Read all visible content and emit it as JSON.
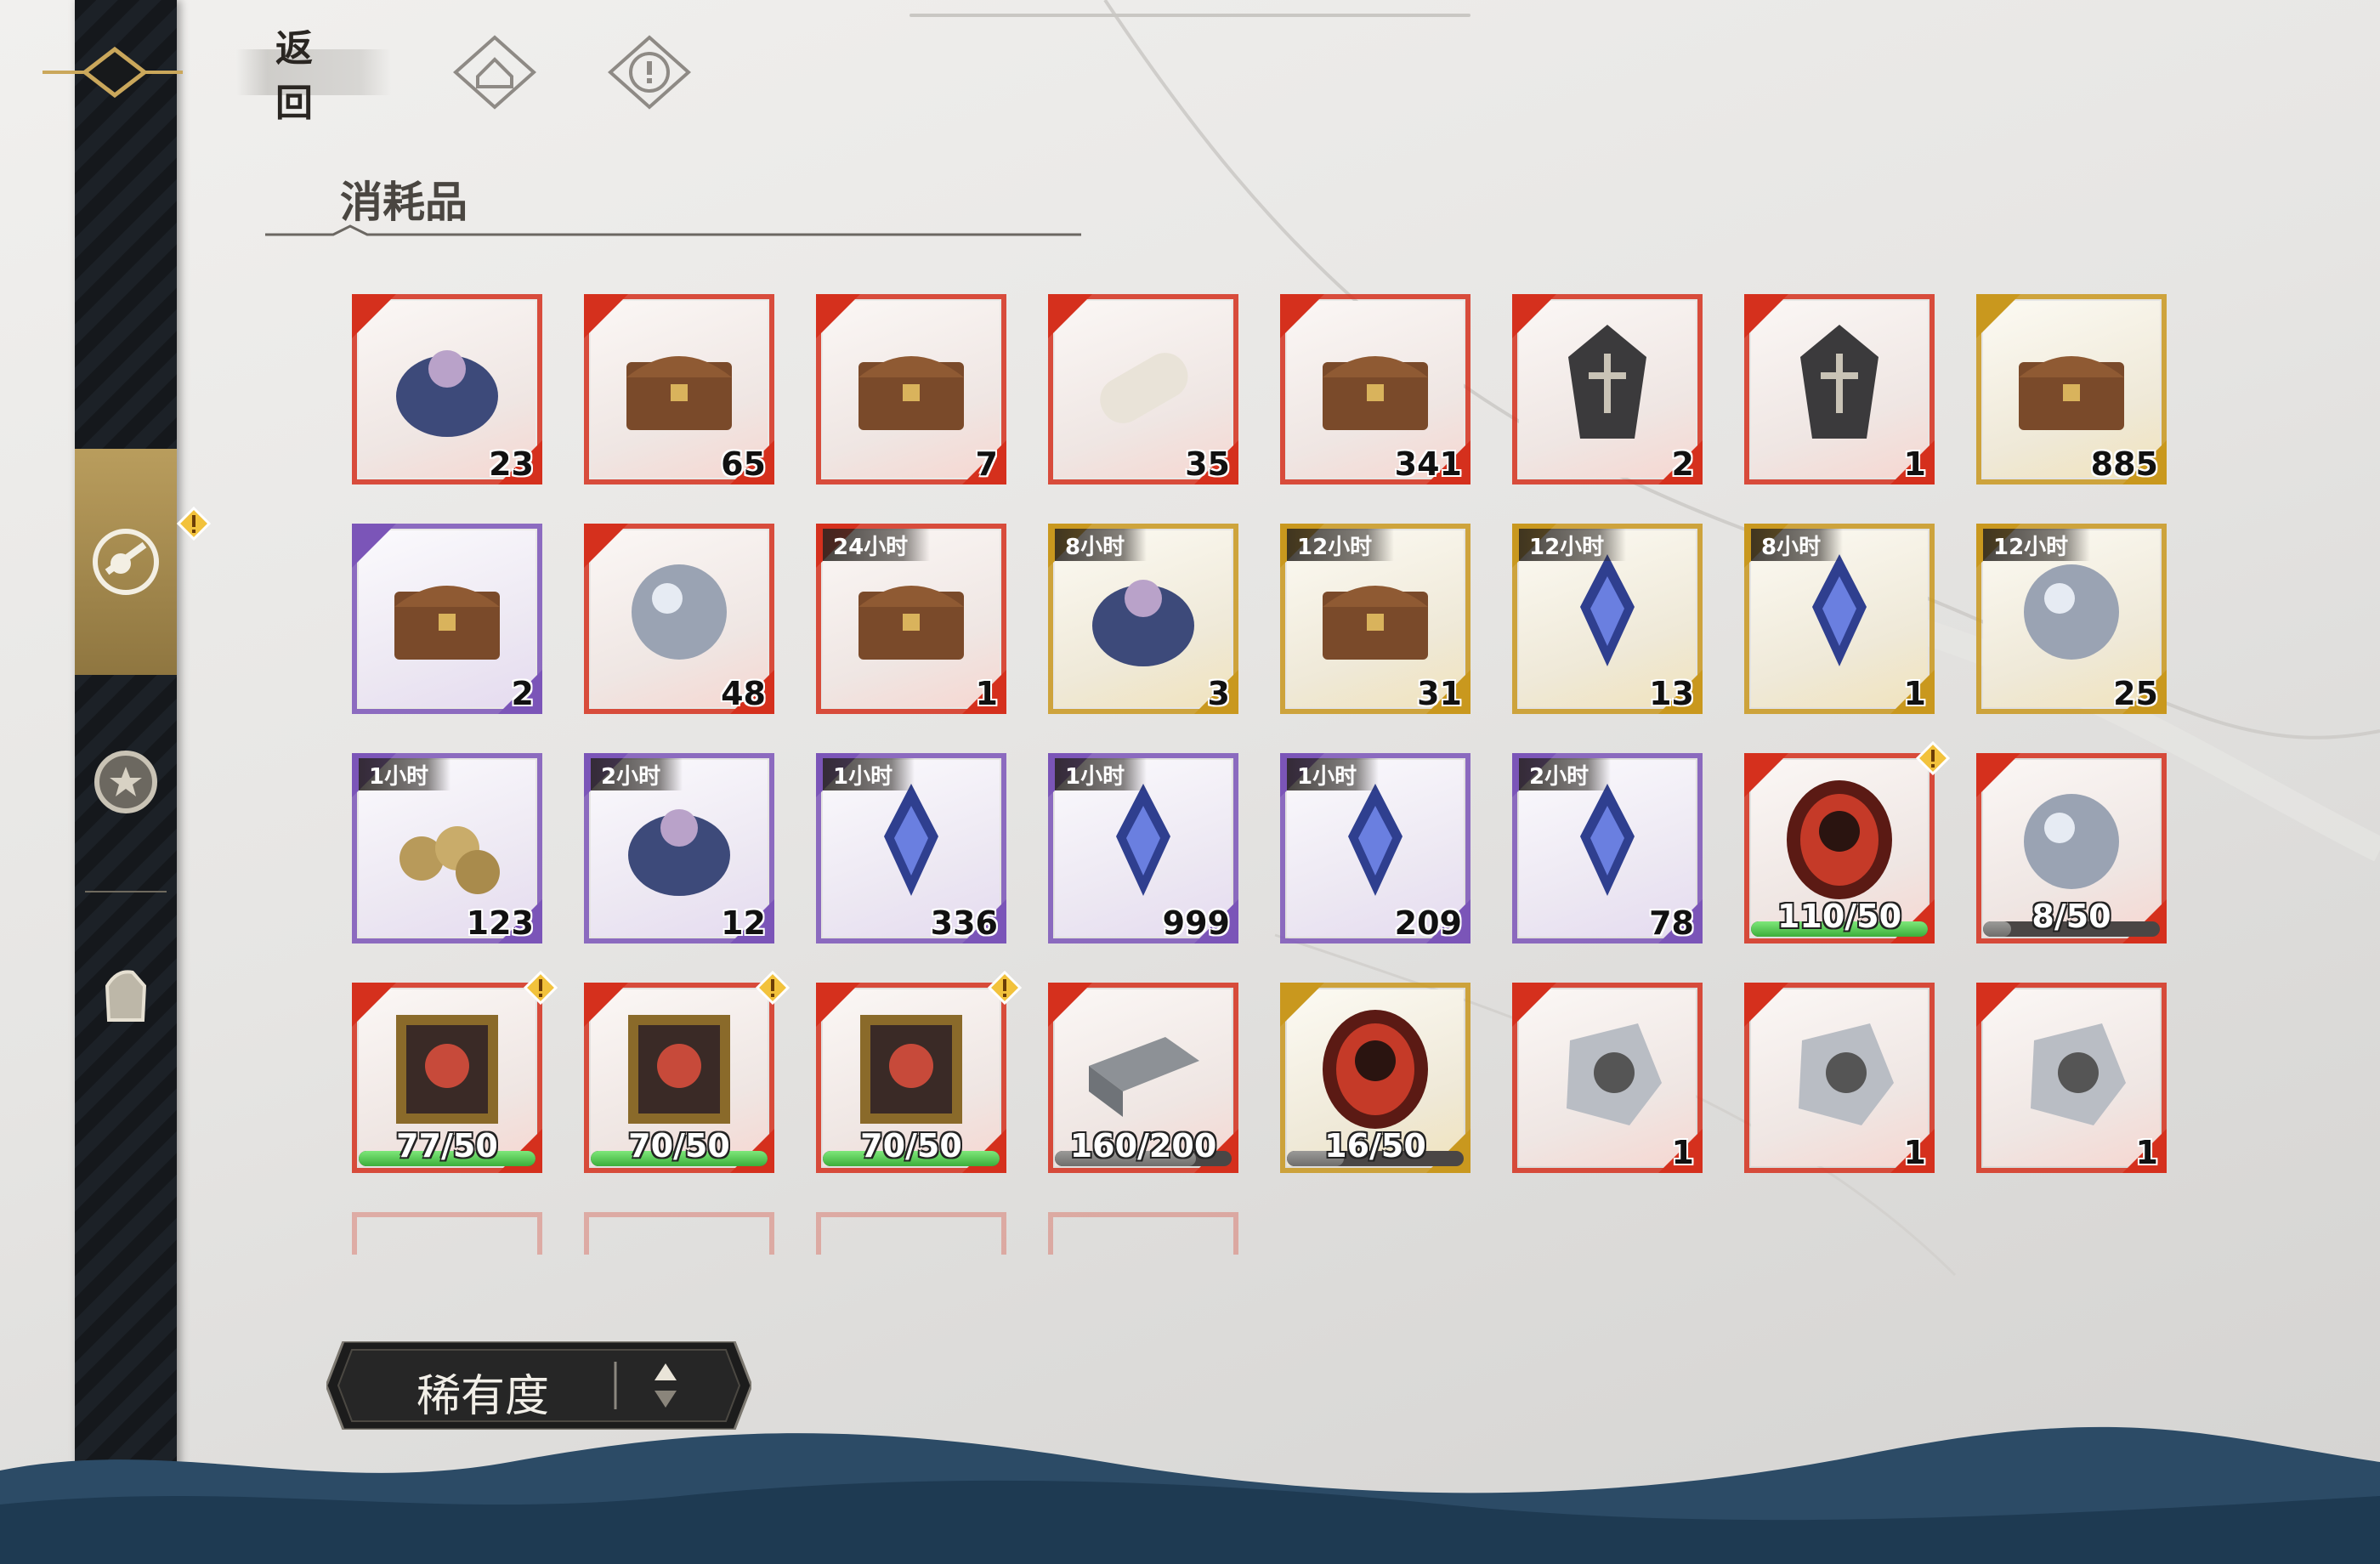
{
  "header": {
    "back_label": "返回",
    "icons": [
      "home-icon",
      "info-icon"
    ]
  },
  "section": {
    "title": "消耗品"
  },
  "sidebar": {
    "tabs": [
      {
        "icon": "consumables-icon",
        "active": true,
        "alert": true
      },
      {
        "icon": "medal-icon",
        "active": false,
        "alert": false
      },
      {
        "icon": "glove-icon",
        "active": false,
        "alert": false
      }
    ]
  },
  "items": [
    {
      "name": "gem-pouch",
      "rarity": "red",
      "count": "23"
    },
    {
      "name": "document-box",
      "rarity": "red",
      "count": "65"
    },
    {
      "name": "red-gift-box",
      "rarity": "red",
      "count": "7"
    },
    {
      "name": "scroll",
      "rarity": "red",
      "count": "35"
    },
    {
      "name": "orb-chest",
      "rarity": "red",
      "count": "341"
    },
    {
      "name": "black-coffin",
      "rarity": "red",
      "count": "2"
    },
    {
      "name": "rose-coffin",
      "rarity": "red",
      "count": "1"
    },
    {
      "name": "gold-chest",
      "rarity": "gold",
      "count": "885"
    },
    {
      "name": "wooden-chest",
      "rarity": "purple",
      "count": "2"
    },
    {
      "name": "mystery-orb",
      "rarity": "red",
      "count": "48"
    },
    {
      "name": "treasure-chest",
      "rarity": "red",
      "count": "1",
      "timer": "24小时"
    },
    {
      "name": "coin-sack",
      "rarity": "gold",
      "count": "3",
      "timer": "8小时"
    },
    {
      "name": "coin-chest",
      "rarity": "gold",
      "count": "31",
      "timer": "12小时"
    },
    {
      "name": "blood-pendant",
      "rarity": "gold",
      "count": "13",
      "timer": "12小时"
    },
    {
      "name": "dark-crystal",
      "rarity": "gold",
      "count": "1",
      "timer": "8小时"
    },
    {
      "name": "galaxy-orb",
      "rarity": "gold",
      "count": "25",
      "timer": "12小时"
    },
    {
      "name": "coins",
      "rarity": "purple",
      "count": "123",
      "timer": "1小时"
    },
    {
      "name": "blue-coin-sack",
      "rarity": "purple",
      "count": "12",
      "timer": "2小时"
    },
    {
      "name": "red-pendant",
      "rarity": "purple",
      "count": "336",
      "timer": "1小时"
    },
    {
      "name": "blue-potion",
      "rarity": "purple",
      "count": "999",
      "timer": "1小时"
    },
    {
      "name": "blue-potion-2",
      "rarity": "purple",
      "count": "209",
      "timer": "1小时"
    },
    {
      "name": "vial",
      "rarity": "purple",
      "count": "78",
      "timer": "2小时"
    }
  ],
  "progress_items": [
    {
      "name": "portrait-silhouette-red",
      "progress": "110/50",
      "fill": 1.0,
      "alert": true
    },
    {
      "name": "portrait-frame-orb",
      "progress": "8/50",
      "fill": 0.16,
      "alert": false
    },
    {
      "name": "portrait-frame-target",
      "progress": "77/50",
      "fill": 1.0,
      "alert": true
    },
    {
      "name": "portrait-frame-spider",
      "progress": "70/50",
      "fill": 1.0,
      "alert": true
    },
    {
      "name": "portrait-frame-spider-2",
      "progress": "70/50",
      "fill": 1.0,
      "alert": true
    },
    {
      "name": "silver-ingot",
      "progress": "160/200",
      "fill": 0.8,
      "alert": false
    },
    {
      "name": "portrait-silhouette-gold",
      "progress": "16/50",
      "fill": 0.32,
      "alert": false
    }
  ],
  "shard_items": [
    {
      "name": "character-shard-1",
      "rarity": "red",
      "count": "1"
    },
    {
      "name": "character-shard-2",
      "rarity": "red",
      "count": "1"
    },
    {
      "name": "character-shard-3",
      "rarity": "red",
      "count": "1"
    }
  ],
  "sort": {
    "label": "稀有度"
  },
  "colors": {
    "red": "#d5301d",
    "purple": "#7b55b8",
    "gold": "#c9981e",
    "progress_green": "#3cae3a",
    "sidebar": "#15181c"
  }
}
